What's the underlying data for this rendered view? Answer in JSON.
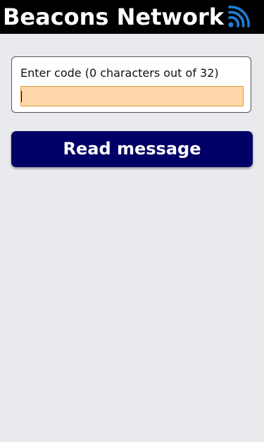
{
  "header": {
    "title": "Beacons Network",
    "icon": "rss-feed-icon",
    "icon_color": "#1e7fd6",
    "background": "#000000"
  },
  "code_form": {
    "label": "Enter code (0 characters out of 32)",
    "value": "",
    "placeholder": "",
    "input_background": "#ffd7a8"
  },
  "actions": {
    "read_message_label": "Read message",
    "button_color": "#000066"
  },
  "page": {
    "background": "#e9eaee"
  }
}
